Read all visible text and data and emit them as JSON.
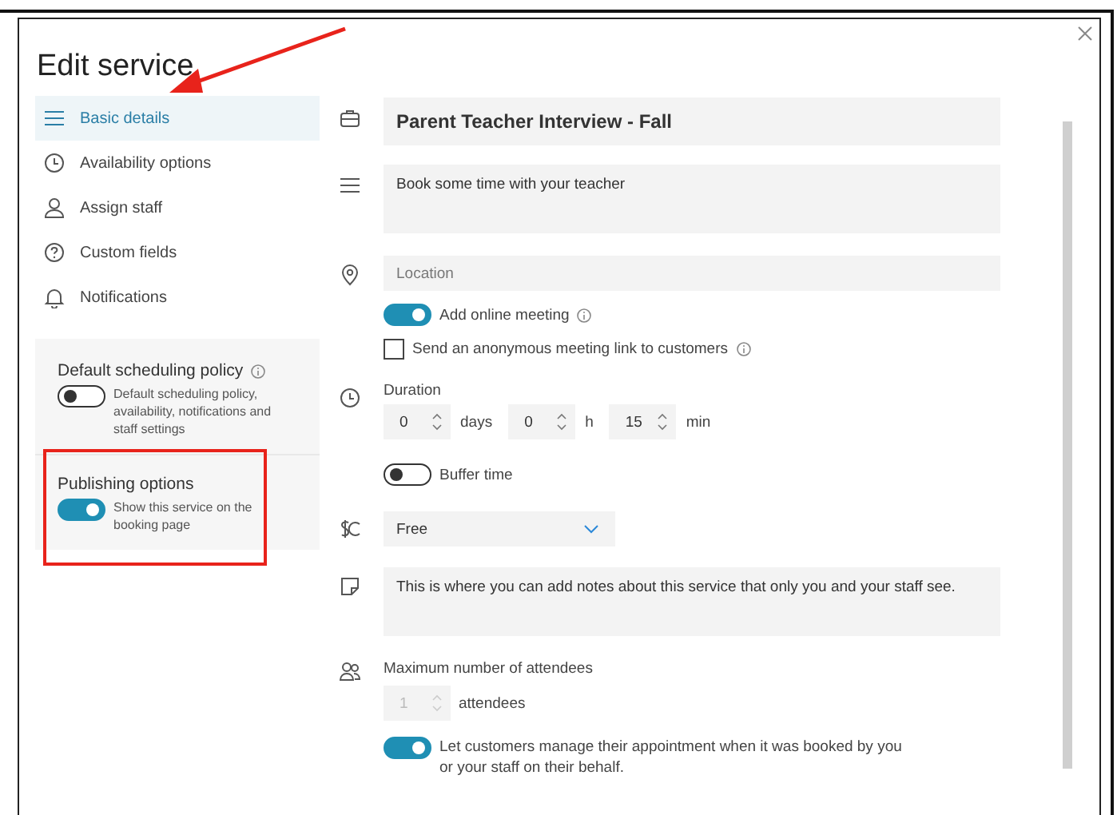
{
  "dialog": {
    "title": "Edit service"
  },
  "nav": [
    {
      "label": "Basic details",
      "selected": true
    },
    {
      "label": "Availability options",
      "selected": false
    },
    {
      "label": "Assign staff",
      "selected": false
    },
    {
      "label": "Custom fields",
      "selected": false
    },
    {
      "label": "Notifications",
      "selected": false
    }
  ],
  "policy": {
    "title": "Default scheduling policy",
    "on": false,
    "description": "Default scheduling policy, availability, notifications and staff settings"
  },
  "publishing": {
    "title": "Publishing options",
    "on": true,
    "description": "Show this service on the booking page"
  },
  "form": {
    "name": {
      "value": "Parent Teacher Interview - Fall"
    },
    "description": {
      "value": "Book some time with your teacher"
    },
    "location": {
      "placeholder": "Location"
    },
    "online_meeting": {
      "label": "Add online meeting",
      "on": true
    },
    "anonymous_link": {
      "label": "Send an anonymous meeting link to customers",
      "checked": false
    },
    "duration": {
      "label": "Duration",
      "fields": [
        {
          "value": "0",
          "unit": "days"
        },
        {
          "value": "0",
          "unit": "h"
        },
        {
          "value": "15",
          "unit": "min"
        }
      ]
    },
    "buffer": {
      "label": "Buffer time",
      "on": false
    },
    "price": {
      "value": "Free"
    },
    "notes": {
      "value": "This is where you can add notes about this service that only you and your staff see."
    },
    "attendees": {
      "label": "Maximum number of attendees",
      "value": "1",
      "unit": "attendees",
      "disabled": true
    },
    "manage": {
      "label": "Let customers manage their appointment when it was booked by you or your staff on their behalf.",
      "on": true
    }
  }
}
